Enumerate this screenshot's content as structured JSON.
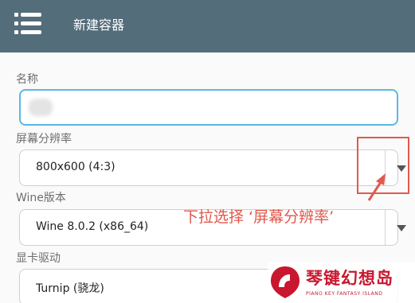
{
  "header": {
    "title": "新建容器",
    "menu_icon": "hamburger-menu-icon"
  },
  "form": {
    "name": {
      "label": "名称",
      "value": ""
    },
    "resolution": {
      "label": "屏幕分辨率",
      "value": "800x600 (4:3)"
    },
    "wine": {
      "label": "Wine版本",
      "value": "Wine 8.0.2 (x86_64)"
    },
    "gpu": {
      "label": "显卡驱动",
      "value": "Turnip (骁龙)"
    }
  },
  "annotation": {
    "text": "下拉选择 ‘屏幕分辨率’",
    "color": "#e0584c"
  },
  "watermark": {
    "text": "琴键幻想岛",
    "subtitle": "PIANO KEY FANTASY ISLAND",
    "color": "#c8172f"
  },
  "colors": {
    "topbar": "#546d7a",
    "focus_border": "#59b8e6"
  }
}
